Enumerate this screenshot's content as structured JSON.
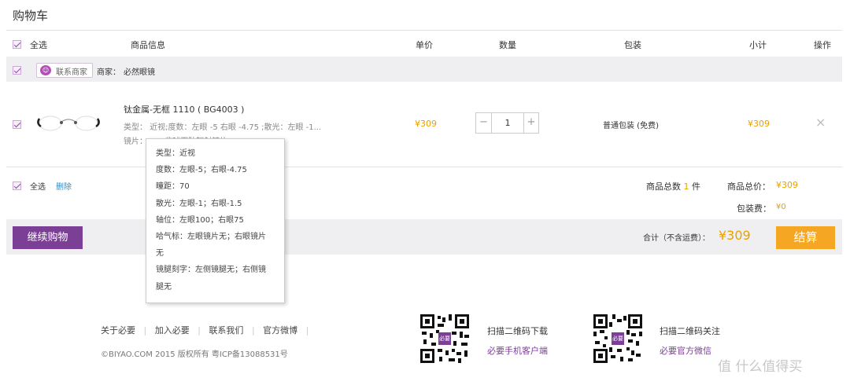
{
  "page_title": "购物车",
  "header": {
    "select_all": "全选",
    "product_info": "商品信息",
    "unit_price": "单价",
    "quantity": "数量",
    "packaging": "包装",
    "subtotal": "小计",
    "operation": "操作"
  },
  "shop": {
    "contact_label": "联系商家",
    "merchant_prefix": "商家：",
    "merchant_name": "必然眼镜"
  },
  "item": {
    "name": "钛金属-无框 1110 ( BG4003 )",
    "spec_line1": "类型： 近视;度数：左眼 -5 右眼 -4.75 ;散光：左眼 -1...",
    "spec_line2": "镜片：1.67非球面防辐射镜片",
    "price": "¥309",
    "qty": "1",
    "packaging": "普通包装 (免费)",
    "subtotal": "¥309",
    "remove": "×"
  },
  "tooltip": {
    "lines": [
      "类型：近视",
      "度数：左眼-5；右眼-4.75",
      "瞳距：70",
      "散光：左眼-1；右眼-1.5",
      "轴位：左眼100；右眼75",
      "哈气标：左眼镜片无；右眼镜片",
      "无",
      "镜腿刻字：左侧镜腿无；右侧镜",
      "腿无"
    ]
  },
  "summary": {
    "select_all": "全选",
    "delete": "删除",
    "total_count_prefix": "商品总数",
    "total_count": "1",
    "total_count_suffix": "件",
    "total_price_label": "商品总价：",
    "total_price": "¥309",
    "packaging_fee_label": "包装费：",
    "packaging_fee": "¥0"
  },
  "checkout_bar": {
    "continue_label": "继续购物",
    "total_label": "合计（不含运费）：",
    "total_value": "¥309",
    "checkout_label": "结算"
  },
  "footer": {
    "links": [
      "关于必要",
      "加入必要",
      "联系我们",
      "官方微博"
    ],
    "copyright": "©BIYAO.COM 2015 版权所有 粤ICP备13088531号",
    "qr1_line1": "扫描二维码下载",
    "qr1_line2": "必要手机客户端",
    "qr2_line1": "扫描二维码关注",
    "qr2_line2": "必要官方微信",
    "qr_badge": "必要"
  },
  "watermark": "值 什么值得买",
  "colors": {
    "accent_purple": "#7b3f95",
    "price_orange": "#e8a100",
    "checkout_orange": "#f5a623"
  }
}
